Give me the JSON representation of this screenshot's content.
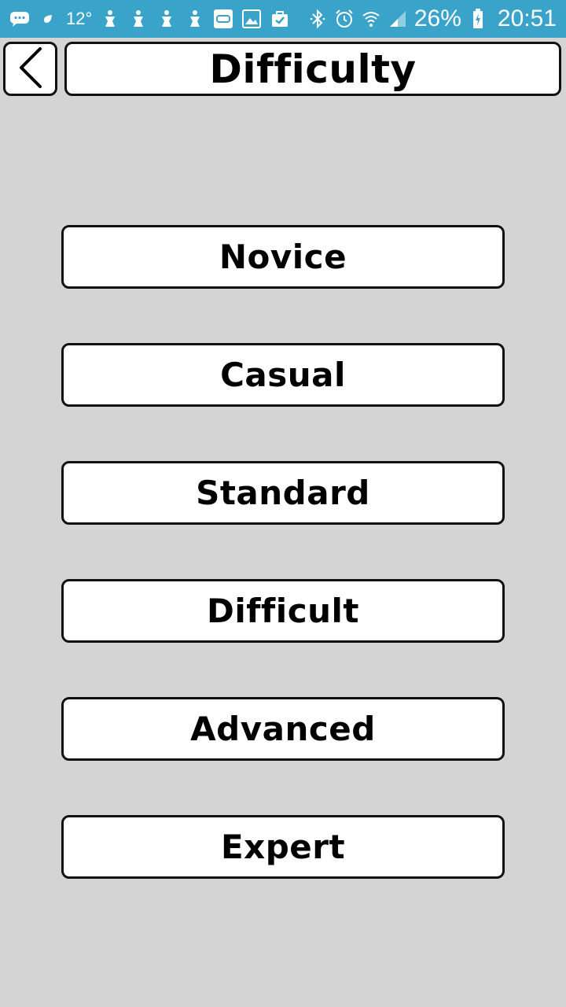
{
  "status_bar": {
    "temperature": "12°",
    "battery_percent": "26%",
    "time": "20:51",
    "background_color": "#3aa3c9",
    "left_icons": [
      "chat-icon",
      "weather-icon",
      "notification-icon",
      "notification-icon",
      "notification-icon",
      "notification-icon",
      "screen-icon",
      "gallery-icon",
      "task-icon"
    ],
    "right_icons": [
      "bluetooth-icon",
      "alarm-icon",
      "wifi-icon",
      "signal-icon",
      "battery-charging-icon"
    ]
  },
  "header": {
    "back_icon": "chevron-left-icon",
    "title": "Difficulty"
  },
  "options": [
    {
      "label": "Novice"
    },
    {
      "label": "Casual"
    },
    {
      "label": "Standard"
    },
    {
      "label": "Difficult"
    },
    {
      "label": "Advanced"
    },
    {
      "label": "Expert"
    }
  ],
  "colors": {
    "background": "#d4d4d4",
    "button_fill": "#ffffff",
    "button_border": "#111111",
    "text": "#000000"
  }
}
